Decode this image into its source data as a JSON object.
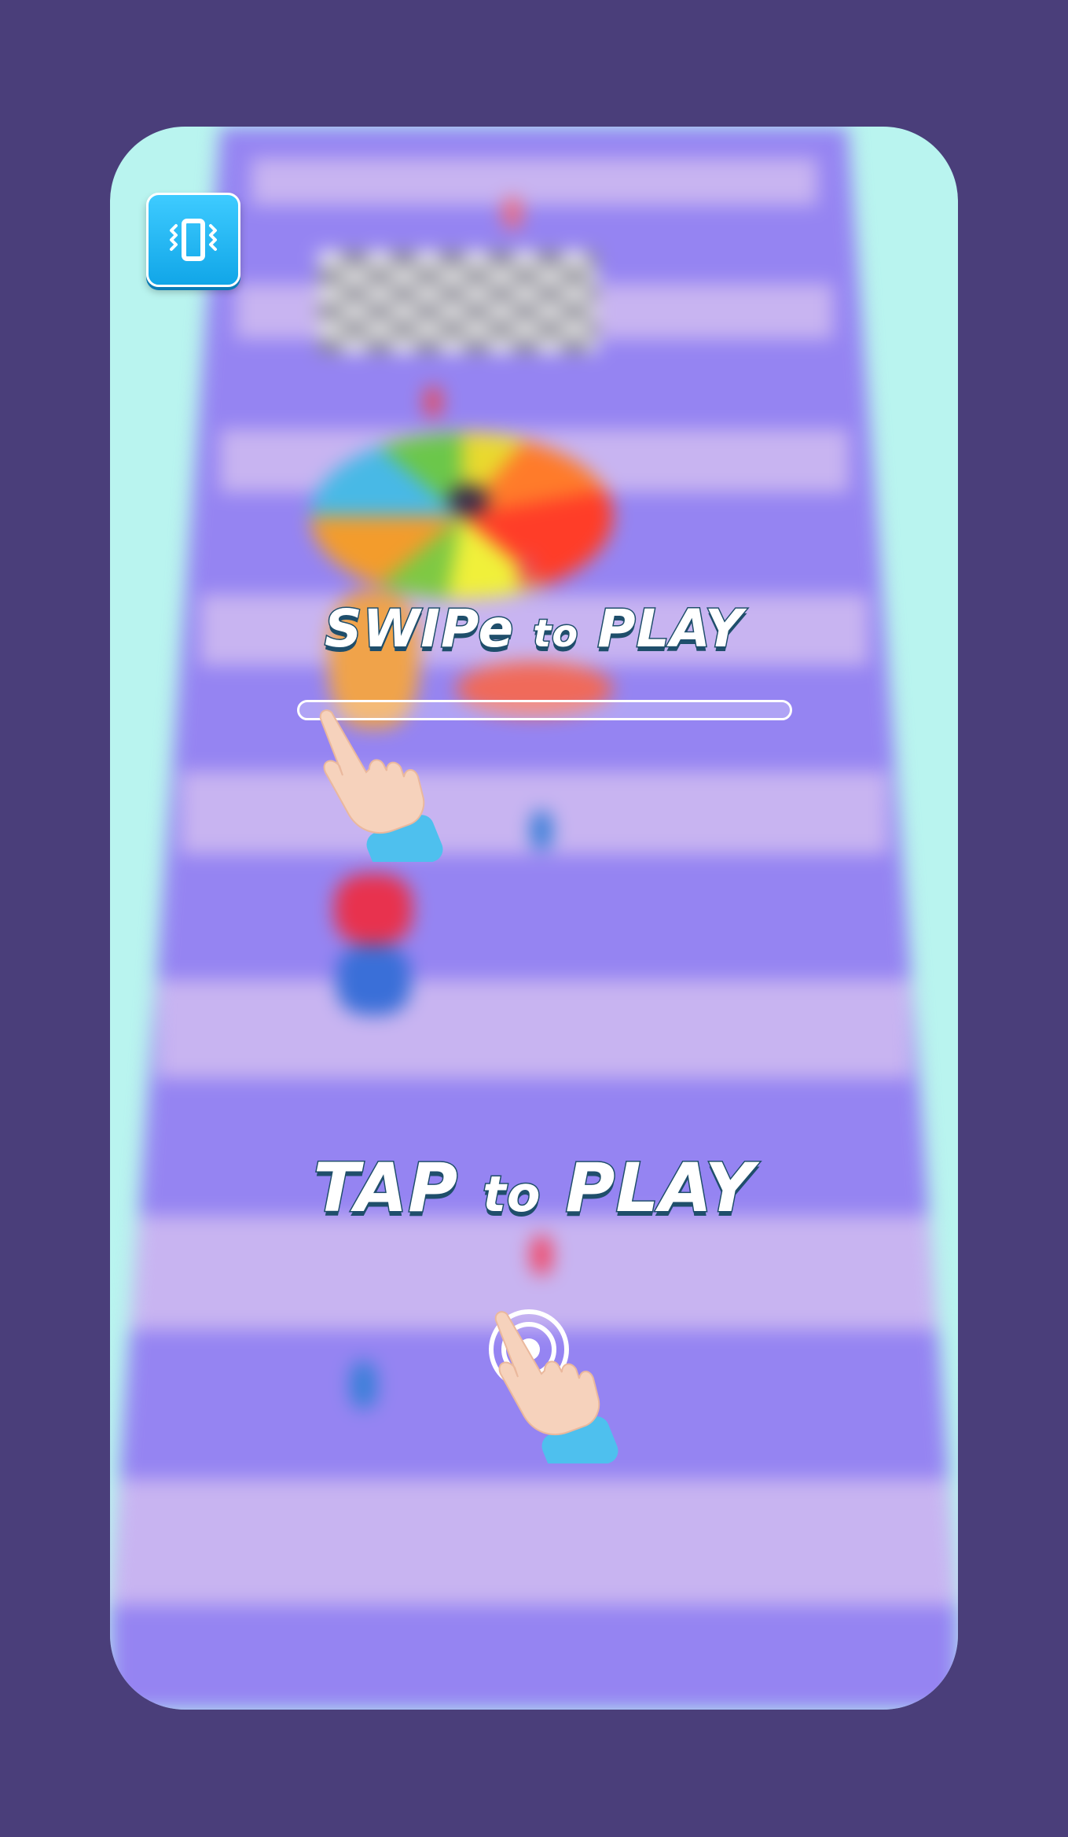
{
  "screen": {
    "background_color": "#4a3e7a",
    "track_color": "#9584f2",
    "stripe_color": "#c8b4f1",
    "side_color": "#b9f4ef"
  },
  "vibration_button": {
    "icon": "vibrate-phone-icon",
    "color": "#1fb8f5"
  },
  "swipe_hint": {
    "word_swipe": "SWIPe",
    "word_to": "to",
    "word_play": "PLAY",
    "icon": "swipe-hand-icon"
  },
  "tap_hint": {
    "word_tap": "TAP",
    "word_to": "to",
    "word_play": "PLAY",
    "icon": "tap-hand-icon"
  }
}
